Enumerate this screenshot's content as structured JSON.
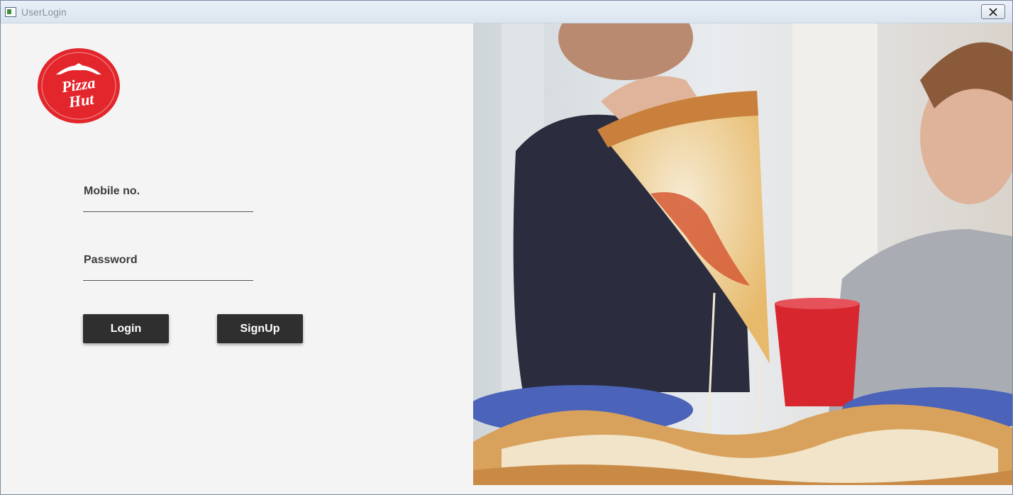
{
  "window": {
    "title": "UserLogin"
  },
  "brand": {
    "logo_text_line1": "Pizza",
    "logo_text_line2": "Hut",
    "color": "#e3262b"
  },
  "form": {
    "mobile_label": "Mobile no.",
    "mobile_value": "",
    "password_label": "Password",
    "password_value": "",
    "login_label": "Login",
    "signup_label": "SignUp"
  },
  "colors": {
    "button_bg": "#2f2f2f",
    "panel_bg": "#f4f4f4"
  }
}
